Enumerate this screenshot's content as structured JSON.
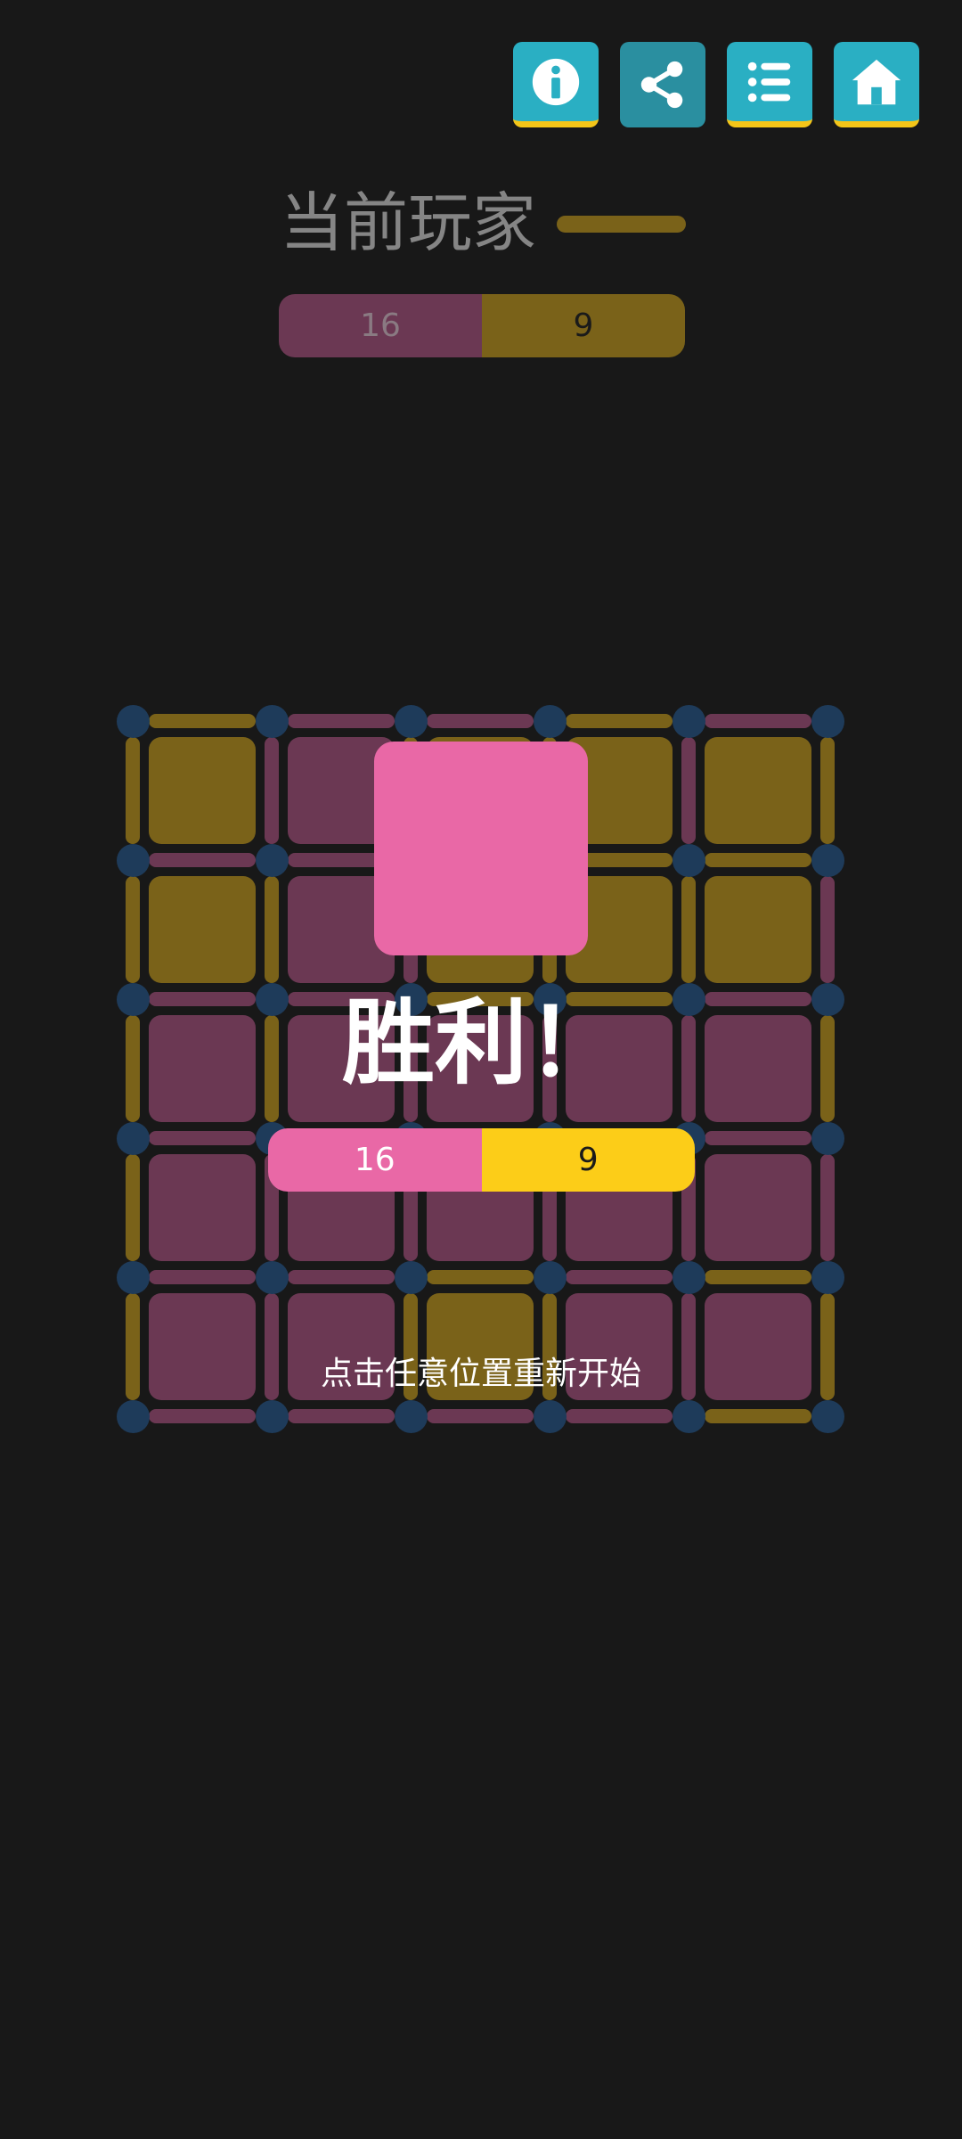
{
  "colors": {
    "background": "#181818",
    "toolbar_button": "#2aafc3",
    "toolbar_button_active": "#2a8fa0",
    "player1_dim": "#6b3853",
    "player2_dim": "#7a6219",
    "player1_bright": "#e968a6",
    "player2_bright": "#fccd18",
    "dot": "#1e3b5a"
  },
  "toolbar": {
    "buttons": [
      {
        "name": "info-button",
        "icon": "info-icon"
      },
      {
        "name": "share-button",
        "icon": "share-icon"
      },
      {
        "name": "list-button",
        "icon": "list-icon"
      },
      {
        "name": "home-button",
        "icon": "home-icon"
      }
    ]
  },
  "header": {
    "current_player_label": "当前玩家",
    "current_player": "player2"
  },
  "score": {
    "player1": "16",
    "player2": "9"
  },
  "board": {
    "rows": 5,
    "cols": 5,
    "cells": [
      [
        "p2",
        "p1",
        "p2",
        "p2",
        "p2"
      ],
      [
        "p2",
        "p1",
        "p2",
        "p2",
        "p2"
      ],
      [
        "p1",
        "p1",
        "p1",
        "p1",
        "p1"
      ],
      [
        "p1",
        "p1",
        "p1",
        "p1",
        "p1"
      ],
      [
        "p1",
        "p1",
        "p2",
        "p1",
        "p1"
      ]
    ],
    "horizontal_edges": [
      [
        "p2",
        "p1",
        "p1",
        "p2",
        "p1"
      ],
      [
        "p1",
        "p1",
        "p2",
        "p2",
        "p2"
      ],
      [
        "p1",
        "p1",
        "p2",
        "p2",
        "p1"
      ],
      [
        "p1",
        "p1",
        "p1",
        "p1",
        "p1"
      ],
      [
        "p1",
        "p1",
        "p2",
        "p1",
        "p2"
      ],
      [
        "p1",
        "p1",
        "p1",
        "p1",
        "p2"
      ]
    ],
    "vertical_edges": [
      [
        "p2",
        "p1",
        "p2",
        "p2",
        "p1",
        "p2"
      ],
      [
        "p2",
        "p2",
        "p1",
        "p2",
        "p2",
        "p1"
      ],
      [
        "p2",
        "p2",
        "p1",
        "p1",
        "p1",
        "p2"
      ],
      [
        "p2",
        "p1",
        "p1",
        "p1",
        "p1",
        "p1"
      ],
      [
        "p2",
        "p1",
        "p2",
        "p2",
        "p1",
        "p2"
      ]
    ]
  },
  "overlay": {
    "title": "胜利！",
    "restart_hint": "点击任意位置重新开始",
    "winner": "player1"
  }
}
